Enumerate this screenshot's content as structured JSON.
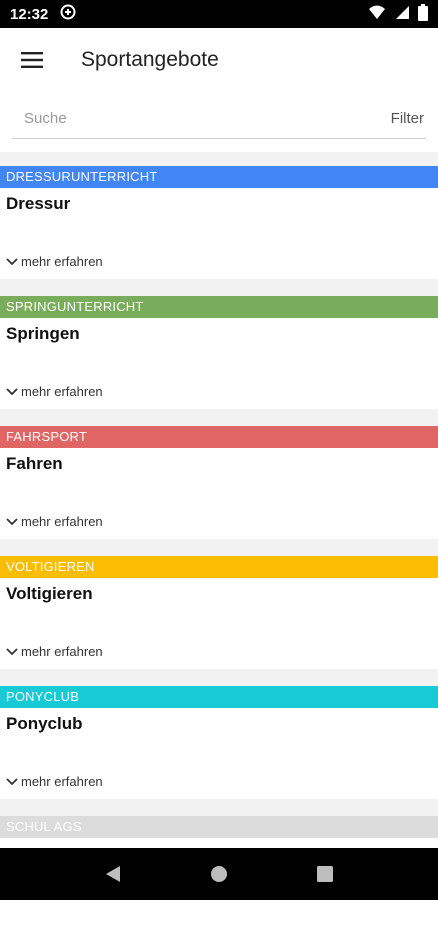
{
  "status_bar": {
    "time": "12:32"
  },
  "app_bar": {
    "title": "Sportangebote"
  },
  "search": {
    "placeholder": "Suche",
    "filter_label": "Filter"
  },
  "cards": [
    {
      "category": "DRESSURUNTERRICHT",
      "title": "Dressur",
      "more": "mehr erfahren",
      "color": "#4285f4"
    },
    {
      "category": "SPRINGUNTERRICHT",
      "title": "Springen",
      "more": "mehr erfahren",
      "color": "#7aad5b"
    },
    {
      "category": "FAHRSPORT",
      "title": "Fahren",
      "more": "mehr erfahren",
      "color": "#e06666"
    },
    {
      "category": "VOLTIGIEREN",
      "title": "Voltigieren",
      "more": "mehr erfahren",
      "color": "#fbbc04"
    },
    {
      "category": "PONYCLUB",
      "title": "Ponyclub",
      "more": "mehr erfahren",
      "color": "#18c9d6"
    },
    {
      "category": "SCHUL AGS",
      "title": "",
      "more": "",
      "color": "#dcdcdc"
    }
  ]
}
